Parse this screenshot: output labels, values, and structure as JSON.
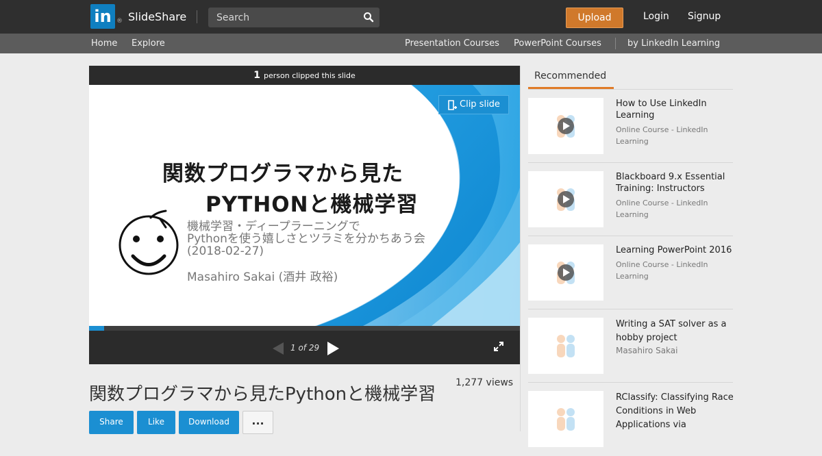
{
  "header": {
    "logo_letters": "in",
    "logo_reg": "®",
    "brand": "SlideShare",
    "search_placeholder": "Search",
    "upload_label": "Upload",
    "login_label": "Login",
    "signup_label": "Signup"
  },
  "subnav": {
    "home": "Home",
    "explore": "Explore",
    "presentation_courses": "Presentation Courses",
    "powerpoint_courses": "PowerPoint Courses",
    "by_linkedin": "by LinkedIn Learning"
  },
  "player": {
    "clip_count": "1",
    "clip_text": "person clipped this slide",
    "clip_button": "Clip slide",
    "page_indicator": "1 of 29",
    "progress_fraction": 0.0345,
    "slide": {
      "title_line1": "関数プログラマから見た",
      "title_line2": "PYTHONと機械学習",
      "subtitle_line1": "機械学習・ディープラーニングで",
      "subtitle_line2": "Pythonを使う嬉しさとツラミを分かちあう会",
      "subtitle_line3": "(2018-02-27)",
      "author": "Masahiro Sakai (酒井 政裕)"
    }
  },
  "deck": {
    "views": "1,277 views",
    "title": "関数プログラマから見たPythonと機械学習",
    "share_label": "Share",
    "like_label": "Like",
    "download_label": "Download",
    "more_label": "..."
  },
  "recommended": {
    "tab_label": "Recommended",
    "items": [
      {
        "title": "How to Use LinkedIn Learning",
        "meta": "Online Course - LinkedIn Learning",
        "video": true
      },
      {
        "title": "Blackboard 9.x Essential Training: Instructors",
        "meta": "Online Course - LinkedIn Learning",
        "video": true
      },
      {
        "title": "Learning PowerPoint 2016",
        "meta": "Online Course - LinkedIn Learning",
        "video": true
      },
      {
        "title": "Writing a SAT solver as a hobby project",
        "meta": "Masahiro Sakai",
        "video": false
      },
      {
        "title": "RClassify: Classifying Race Conditions in Web Applications via",
        "meta": "",
        "video": false
      }
    ]
  },
  "colors": {
    "accent_blue": "#1b8fd2",
    "upload_orange": "#d0792b",
    "tab_orange": "#e07b27"
  }
}
